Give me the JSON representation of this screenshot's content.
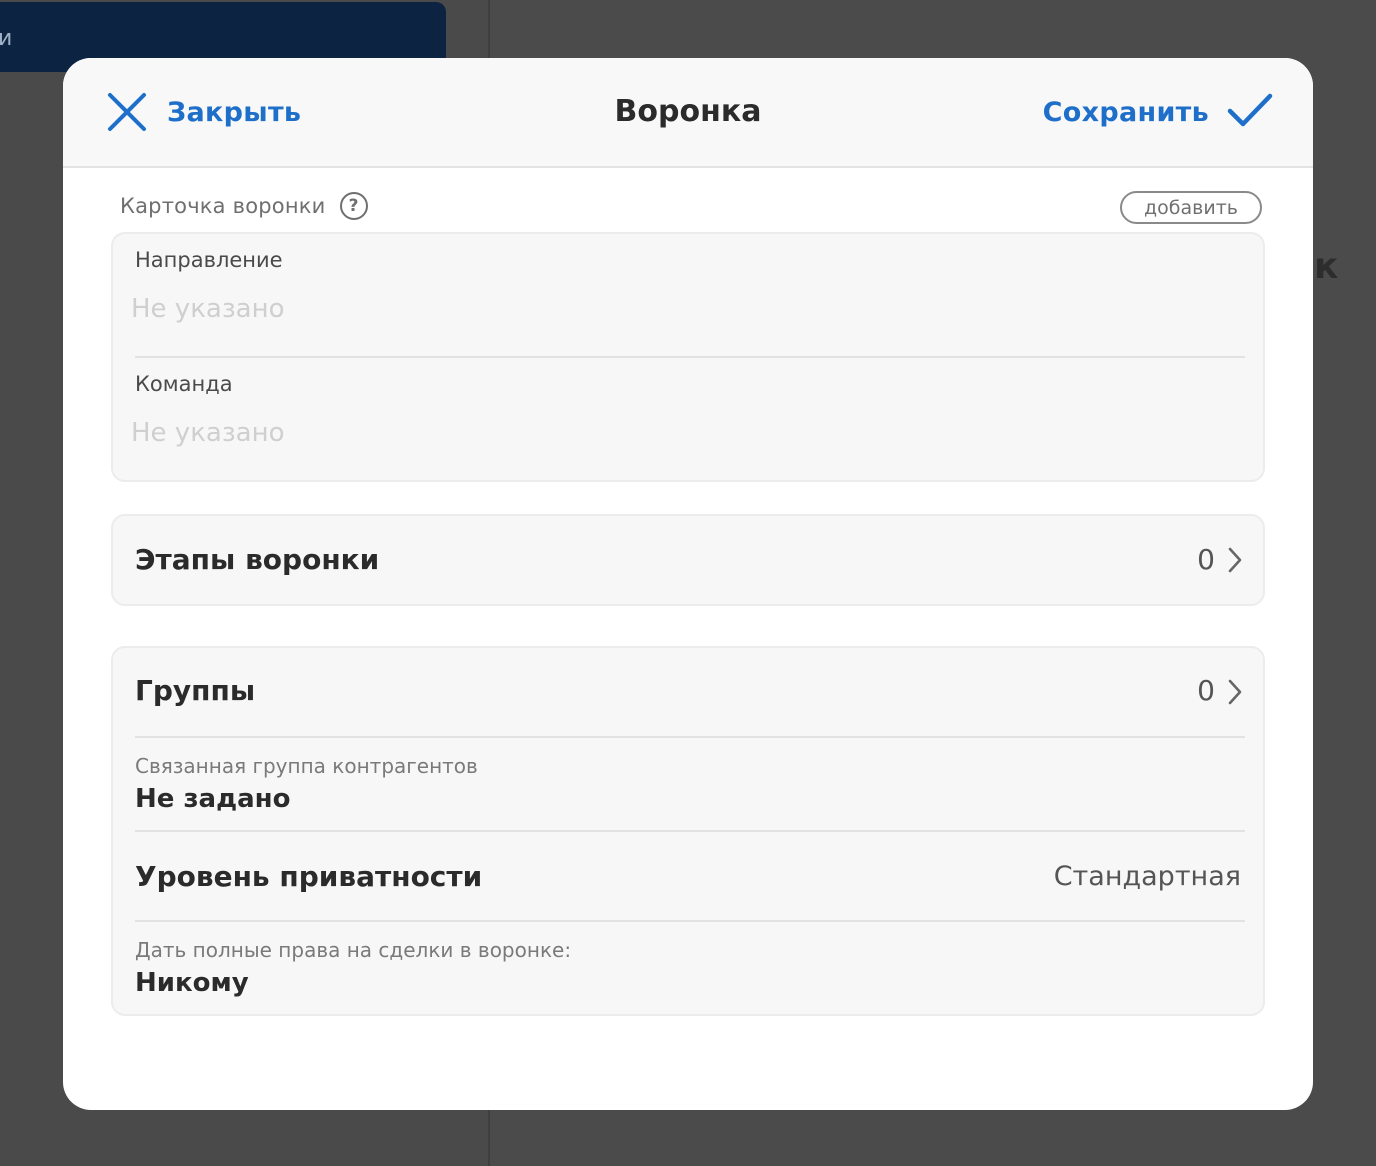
{
  "background": {
    "topbar_fragment": "и",
    "right_fragment": "к"
  },
  "modal": {
    "close_label": "Закрыть",
    "title": "Воронка",
    "save_label": "Сохранить",
    "accent_color": "#1e6fc9"
  },
  "funnel_card": {
    "section_label": "Карточка воронки",
    "help_glyph": "?",
    "add_label": "добавить",
    "fields": [
      {
        "label": "Направление",
        "placeholder": "Не указано"
      },
      {
        "label": "Команда",
        "placeholder": "Не указано"
      }
    ]
  },
  "stages": {
    "title": "Этапы воронки",
    "count": "0"
  },
  "groups": {
    "title": "Группы",
    "count": "0",
    "linked_group_label": "Связанная группа контрагентов",
    "linked_group_value": "Не задано",
    "privacy_label": "Уровень приватности",
    "privacy_value": "Стандартная",
    "full_rights_label": "Дать полные права на сделки в воронке:",
    "full_rights_value": "Никому"
  }
}
